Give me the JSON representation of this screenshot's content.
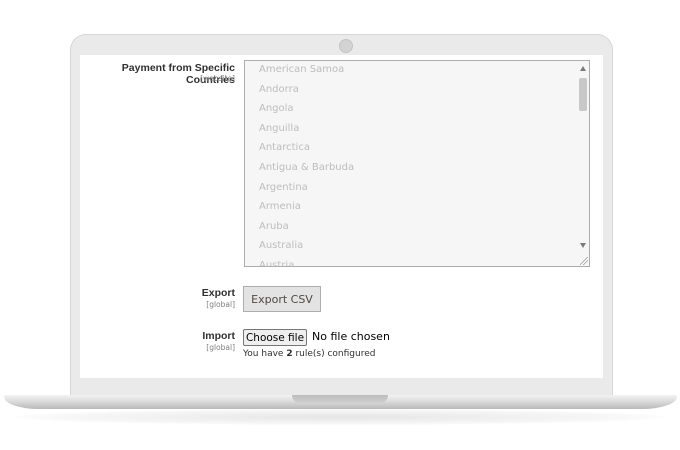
{
  "config": {
    "countries_label": "Payment from Specific Countries",
    "countries_scope": "[website]",
    "countries": [
      "American Samoa",
      "Andorra",
      "Angola",
      "Anguilla",
      "Antarctica",
      "Antigua & Barbuda",
      "Argentina",
      "Armenia",
      "Aruba",
      "Australia",
      "Austria"
    ],
    "export_label": "Export",
    "export_scope": "[global]",
    "export_button": "Export CSV",
    "import_label": "Import",
    "import_scope": "[global]",
    "choose_file_button": "Choose file",
    "no_file_text": "No file chosen",
    "rules_prefix": "You have ",
    "rules_count": "2",
    "rules_suffix": " rule(s) configured"
  }
}
